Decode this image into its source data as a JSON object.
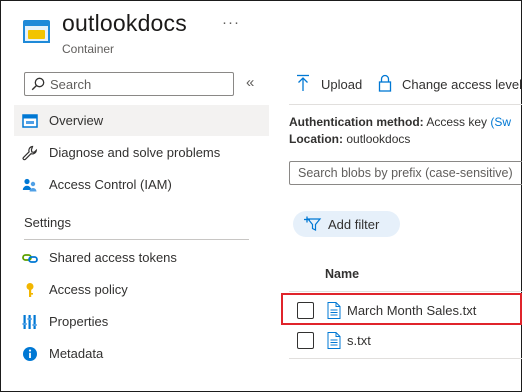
{
  "header": {
    "title": "outlookdocs",
    "subtitle": "Container",
    "more": "···",
    "icon": "storage-container-icon"
  },
  "sidebar": {
    "search_placeholder": "Search",
    "collapse": "«",
    "items": [
      {
        "label": "Overview",
        "icon": "overview-icon",
        "selected": true
      },
      {
        "label": "Diagnose and solve problems",
        "icon": "wrench-icon"
      },
      {
        "label": "Access Control (IAM)",
        "icon": "people-icon"
      }
    ],
    "settings_heading": "Settings",
    "settings_items": [
      {
        "label": "Shared access tokens",
        "icon": "link-icon"
      },
      {
        "label": "Access policy",
        "icon": "key-icon"
      },
      {
        "label": "Properties",
        "icon": "properties-icon"
      },
      {
        "label": "Metadata",
        "icon": "info-icon"
      }
    ]
  },
  "toolbar": {
    "upload": "Upload",
    "change_access": "Change access level"
  },
  "info": {
    "auth_label": "Authentication method:",
    "auth_value": "Access key",
    "auth_link": "(Sw",
    "location_label": "Location:",
    "location_value": "outlookdocs"
  },
  "blob_search_placeholder": "Search blobs by prefix (case-sensitive)",
  "add_filter": "Add filter",
  "table": {
    "column_name": "Name",
    "rows": [
      {
        "name": "March Month Sales.txt",
        "highlighted": true
      },
      {
        "name": "s.txt",
        "highlighted": false
      }
    ]
  },
  "colors": {
    "accent": "#0078d4",
    "highlight": "#e0242b",
    "selected_bg": "#f3f2f1"
  }
}
